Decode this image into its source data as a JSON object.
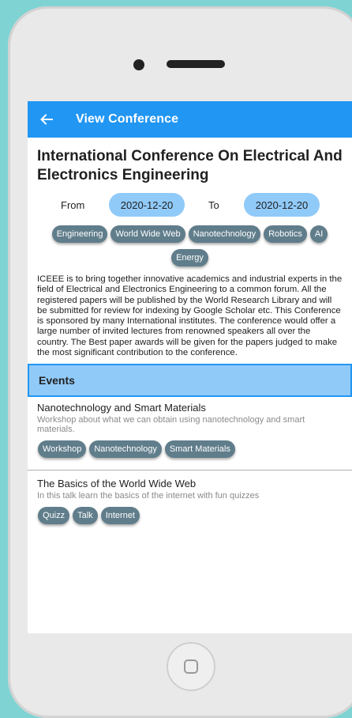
{
  "appbar": {
    "title": "View Conference",
    "back_icon": "arrow-left-icon"
  },
  "conference": {
    "title": "International Conference On Electrical And Electronics Engineering",
    "from_label": "From",
    "from_date": "2020-12-20",
    "to_label": "To",
    "to_date": "2020-12-20",
    "tags": [
      "Engineering",
      "World Wide Web",
      "Nanotechnology",
      "Robotics",
      "AI",
      "Energy"
    ],
    "description": "ICEEE is to bring together innovative academics and industrial experts in the field of Electrical and Electronics Engineering to a common forum. All the registered papers will be published by the World Research Library and will be submitted for review for indexing by Google Scholar etc. This Conference is sponsored by many International institutes. The conference would offer a large number of invited lectures from renowned speakers all over the country. The Best paper awards will be given for the papers judged to make the most significant contribution to the conference."
  },
  "events": {
    "header": "Events",
    "items": [
      {
        "title": "Nanotechnology and Smart Materials",
        "description": "Workshop about what we can obtain using nanotechnology and smart materials.",
        "tags": [
          "Workshop",
          "Nanotechnology",
          "Smart Materials"
        ]
      },
      {
        "title": "The Basics of the World Wide Web",
        "description": "In this talk learn the basics of the internet with fun quizzes",
        "tags": [
          "Quizz",
          "Talk",
          "Internet"
        ]
      }
    ]
  },
  "colors": {
    "primary": "#2196f3",
    "light_primary": "#90caf9",
    "chip": "#607d8b",
    "background": "#7fd3d3"
  }
}
